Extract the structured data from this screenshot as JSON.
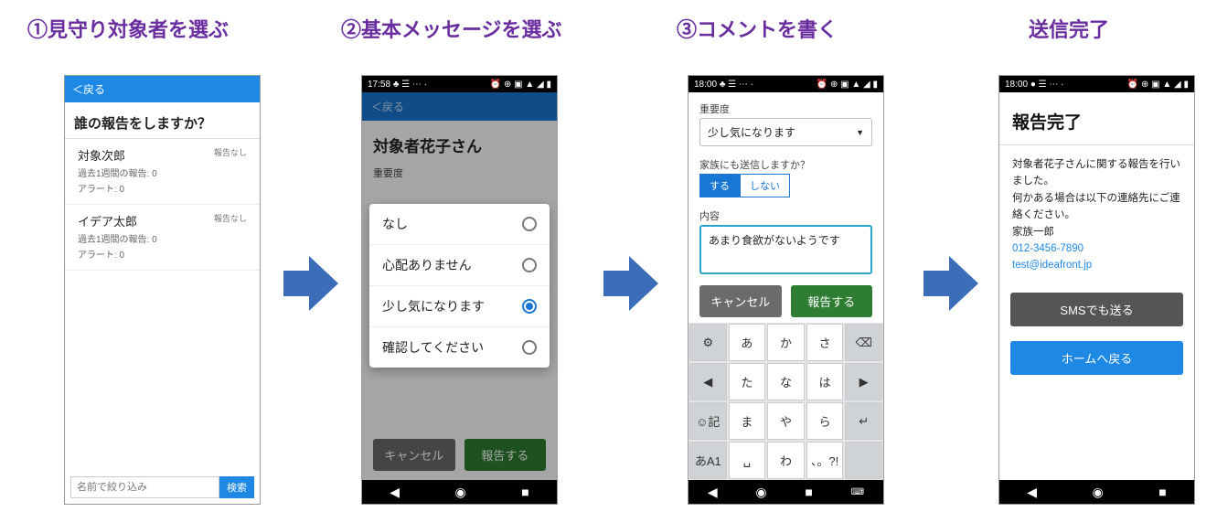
{
  "steps": {
    "s1": "①見守り対象者を選ぶ",
    "s2": "②基本メッセージを選ぶ",
    "s3": "③コメントを書く",
    "s4": "送信完了"
  },
  "phone1": {
    "back": "＜戻る",
    "question": "誰の報告をしますか？",
    "items": [
      {
        "name": "対象次郎",
        "status": "報告なし",
        "week": "過去1週間の報告: 0",
        "alert": "アラート: 0"
      },
      {
        "name": "イデア太郎",
        "status": "報告なし",
        "week": "過去1週間の報告: 0",
        "alert": "アラート: 0"
      }
    ],
    "search_placeholder": "名前で絞り込み",
    "search_btn": "検索"
  },
  "phone2": {
    "time": "17:58",
    "icons": "♣ ☰ ⋯ ·",
    "right_icons": "⏰ ⊕ ▣ ▲ ◢ ▮",
    "back": "＜戻る",
    "subject": "対象者花子さん",
    "sev_label": "重要度",
    "cancel": "キャンセル",
    "report": "報告する",
    "options": [
      {
        "label": "なし",
        "selected": false
      },
      {
        "label": "心配ありません",
        "selected": false
      },
      {
        "label": "少し気になります",
        "selected": true
      },
      {
        "label": "確認してください",
        "selected": false
      }
    ]
  },
  "phone3": {
    "time": "18:00",
    "icons": "♣ ☰ ⋯ ·",
    "right_icons": "⏰ ⊕ ▣ ▲ ◢ ▮",
    "sev_label": "重要度",
    "sev_value": "少し気になります",
    "family_q": "家族にも送信しますか？",
    "yes": "する",
    "no": "しない",
    "content_label": "内容",
    "content_value": "あまり食欲がないようです",
    "cancel": "キャンセル",
    "report": "報告する",
    "kbd": {
      "r1": [
        "⚙",
        "あ",
        "か",
        "さ",
        "⌫"
      ],
      "r2": [
        "◀",
        "た",
        "な",
        "は",
        "▶"
      ],
      "r3": [
        "☺記",
        "ま",
        "や",
        "ら",
        "↵"
      ],
      "r4": [
        "あA1",
        "␣",
        "わ",
        "、。?!",
        ""
      ]
    }
  },
  "phone4": {
    "time": "18:00",
    "icons": "● ☰ ⋯ ·",
    "right_icons": "⏰ ⊕ ▣ ▲ ◢ ▮",
    "title": "報告完了",
    "line1": "対象者花子さんに関する報告を行いました。",
    "line2": "何かある場合は以下の連絡先にご連絡ください。",
    "contact_name": "家族一郎",
    "contact_tel": "012-3456-7890",
    "contact_mail": "test@ideafront.jp",
    "sms_btn": "SMSでも送る",
    "home_btn": "ホームへ戻る"
  }
}
